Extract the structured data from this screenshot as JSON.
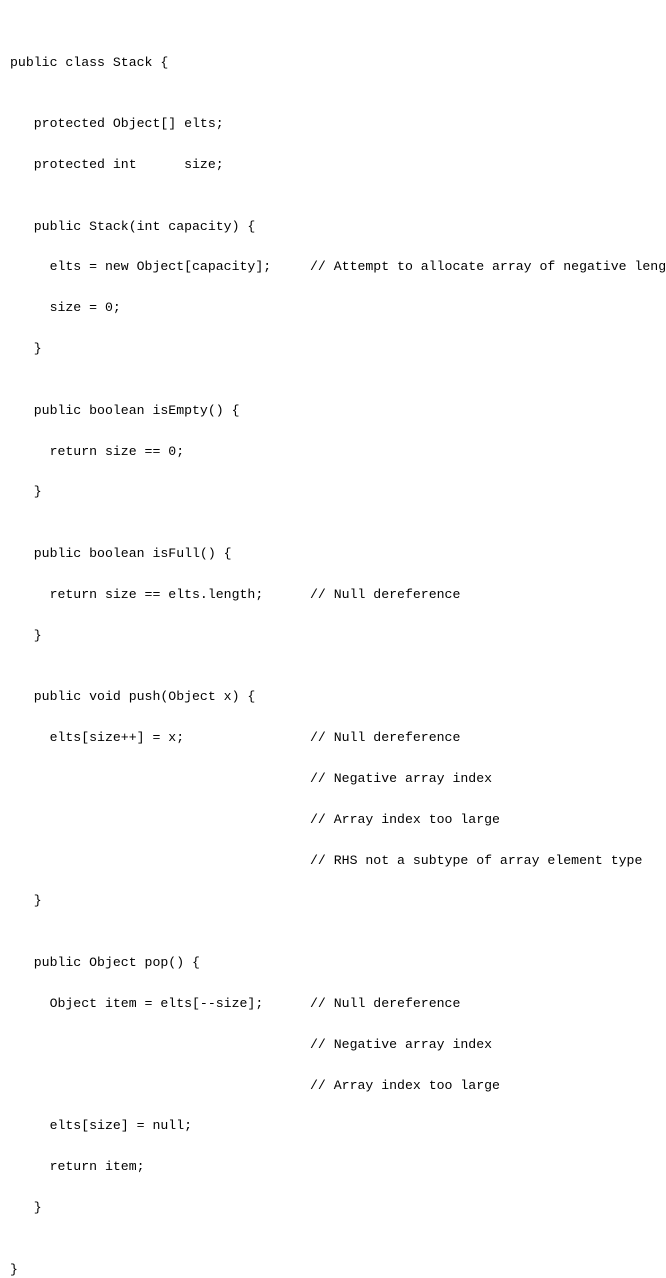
{
  "class_decl": "public class Stack {",
  "field1": "   protected Object[] elts;",
  "field2": "   protected int      size;",
  "ctor_sig": "   public Stack(int capacity) {",
  "ctor_l1_code": "     elts = new Object[capacity];",
  "ctor_l1_cmt": "// Attempt to allocate array of negative length",
  "ctor_l2": "     size = 0;",
  "ctor_close": "   }",
  "isEmpty_sig": "   public boolean isEmpty() {",
  "isEmpty_body": "     return size == 0;",
  "isEmpty_close": "   }",
  "isFull_sig": "   public boolean isFull() {",
  "isFull_body_code": "     return size == elts.length;",
  "isFull_body_cmt": "// Null dereference",
  "isFull_close": "   }",
  "push_sig": "   public void push(Object x) {",
  "push_body_code": "     elts[size++] = x;",
  "push_cmt1": "// Null dereference",
  "push_cmt2": "// Negative array index",
  "push_cmt3": "// Array index too large",
  "push_cmt4": "// RHS not a subtype of array element type",
  "push_close": "   }",
  "pop_sig": "   public Object pop() {",
  "pop_l1_code": "     Object item = elts[--size];",
  "pop_l1_cmt1": "// Null dereference",
  "pop_l1_cmt2": "// Negative array index",
  "pop_l1_cmt3": "// Array index too large",
  "pop_l2": "     elts[size] = null;",
  "pop_l3": "     return item;",
  "pop_close": "   }",
  "class_close": "}",
  "blank": ""
}
